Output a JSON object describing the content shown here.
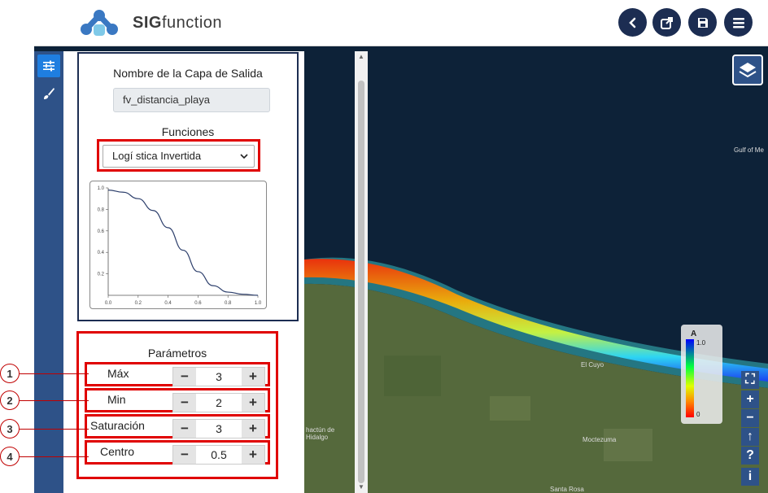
{
  "app": {
    "title_bold": "SIG",
    "title_rest": "function"
  },
  "header": {
    "buttons": [
      {
        "name": "back-button",
        "icon": "chevron-left-icon"
      },
      {
        "name": "share-button",
        "icon": "share-icon"
      },
      {
        "name": "save-button",
        "icon": "save-icon"
      },
      {
        "name": "menu-button",
        "icon": "menu-icon"
      }
    ]
  },
  "panel": {
    "output_layer_label": "Nombre de la Capa de Salida",
    "output_layer_value": "fv_distancia_playa",
    "functions_label": "Funciones",
    "function_selected": "Logí stica Invertida",
    "params_title": "Parámetros",
    "params": [
      {
        "callout": "1",
        "label": "Máx",
        "value": "3"
      },
      {
        "callout": "2",
        "label": "Min",
        "value": "2"
      },
      {
        "callout": "3",
        "label": "Saturación",
        "value": "3"
      },
      {
        "callout": "4",
        "label": "Centro",
        "value": "0.5"
      }
    ],
    "minus": "−",
    "plus": "+"
  },
  "chart_data": {
    "type": "line",
    "title": "",
    "xlabel": "",
    "ylabel": "",
    "xlim": [
      0,
      1.0
    ],
    "ylim": [
      0,
      1.0
    ],
    "xticks": [
      "0.0",
      "0.2",
      "0.4",
      "0.6",
      "0.8",
      "1.0"
    ],
    "yticks": [
      "0.2",
      "0.4",
      "0.6",
      "0.8",
      "1.0"
    ],
    "series": [
      {
        "x": [
          0.0,
          0.1,
          0.2,
          0.3,
          0.4,
          0.5,
          0.6,
          0.7,
          0.8,
          0.9,
          1.0
        ],
        "y": [
          0.98,
          0.96,
          0.9,
          0.79,
          0.63,
          0.42,
          0.22,
          0.09,
          0.03,
          0.01,
          0.0
        ]
      }
    ],
    "line_color": "#2c3e6b"
  },
  "legend": {
    "title": "A",
    "max": "1.0",
    "min": "0"
  },
  "map_labels": {
    "gulf": "Gulf of Me",
    "town1": "El Cuyo",
    "town2": "hactún de Hidalgo",
    "town3": "Moctezuma",
    "town4": "Santa Rosa"
  },
  "map_controls": [
    {
      "name": "fullscreen-icon",
      "glyph": "⛶"
    },
    {
      "name": "zoom-in-icon",
      "glyph": "+"
    },
    {
      "name": "zoom-out-icon",
      "glyph": "−"
    },
    {
      "name": "north-arrow-icon",
      "glyph": "↑"
    },
    {
      "name": "help-icon",
      "glyph": "?"
    },
    {
      "name": "info-icon",
      "glyph": "i"
    }
  ],
  "colors": {
    "brand": "#1c2d52",
    "toolstrip": "#2e5288",
    "highlight": "#e00000"
  }
}
